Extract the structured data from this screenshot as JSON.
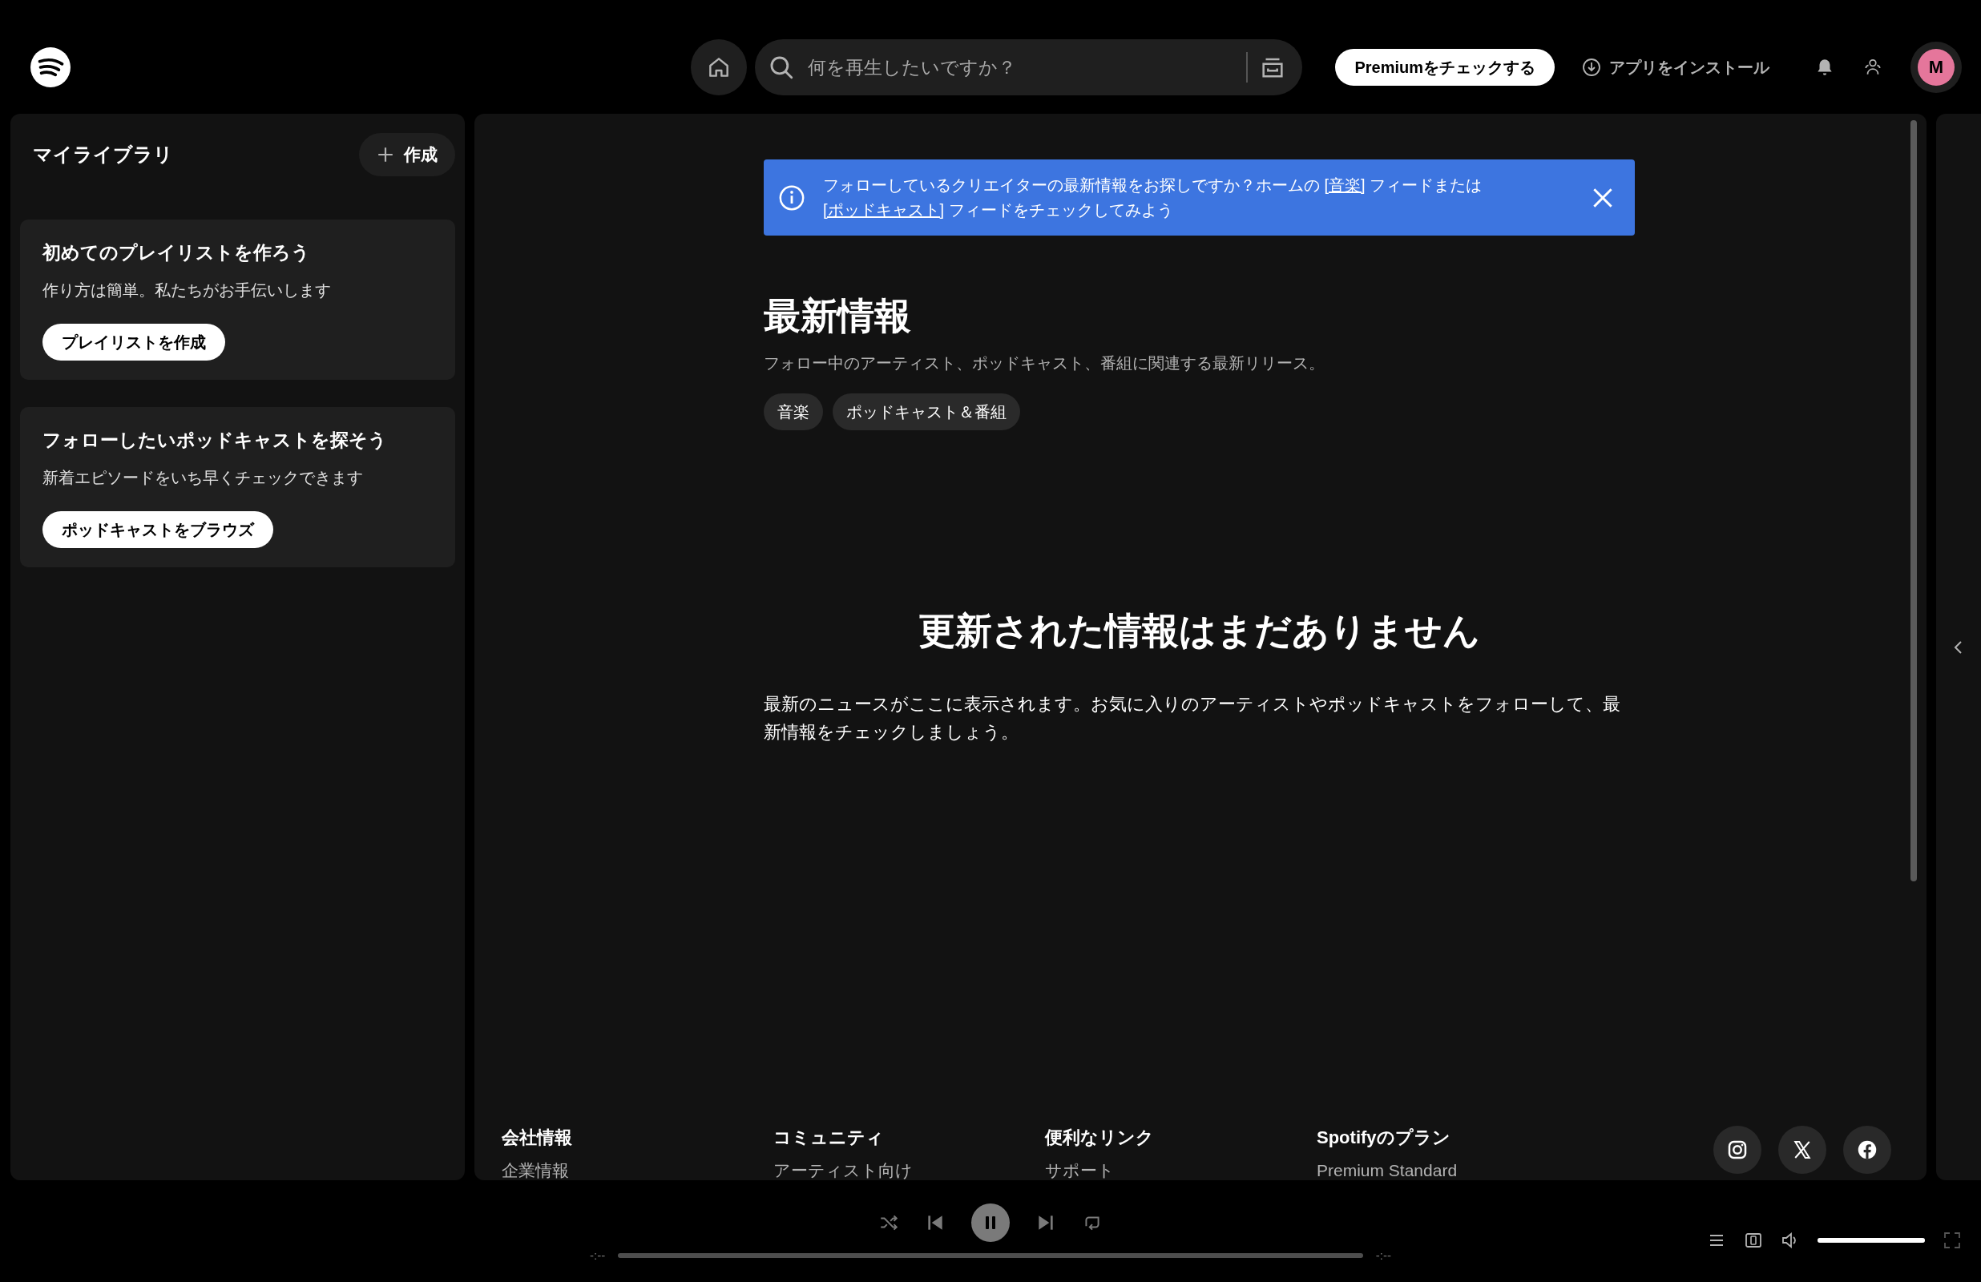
{
  "topbar": {
    "search": {
      "placeholder": "何を再生したいですか？"
    },
    "premium_button": "Premiumをチェックする",
    "install_link": "アプリをインストール",
    "avatar": "M"
  },
  "library": {
    "title": "マイライブラリ",
    "create_button": "作成",
    "cards": [
      {
        "title": "初めてのプレイリストを作ろう",
        "text": "作り方は簡単。私たちがお手伝いします",
        "button": "プレイリストを作成"
      },
      {
        "title": "フォローしたいポッドキャストを探そう",
        "text": "新着エピソードをいち早くチェックできます",
        "button": "ポッドキャストをブラウズ"
      }
    ]
  },
  "banner": {
    "segments": [
      {
        "kind": "text",
        "text": "フォローしているクリエイターの最新情報をお探しですか？ホームの "
      },
      {
        "kind": "link",
        "text": "[音楽]"
      },
      {
        "kind": "text",
        "text": " フィードまたは "
      },
      {
        "kind": "link",
        "text": "[ポッドキャスト]"
      },
      {
        "kind": "text",
        "text": " フィードをチェックしてみよう"
      }
    ]
  },
  "main": {
    "title": "最新情報",
    "subtitle": "フォロー中のアーティスト、ポッドキャスト、番組に関連する最新リリース。",
    "filters": [
      {
        "label": "音楽",
        "selected": false
      },
      {
        "label": "ポッドキャスト＆番組",
        "selected": false
      }
    ],
    "empty_title": "更新された情報はまだありません",
    "empty_text": "最新のニュースがここに表示されます。お気に入りのアーティストやポッドキャストをフォローして、最新情報をチェックしましょう。"
  },
  "footer": {
    "columns": [
      {
        "heading": "会社情報",
        "links": [
          "企業情報"
        ]
      },
      {
        "heading": "コミュニティ",
        "links": [
          "アーティスト向け"
        ]
      },
      {
        "heading": "便利なリンク",
        "links": [
          "サポート"
        ]
      },
      {
        "heading": "Spotifyのプラン",
        "links": [
          "Premium Standard"
        ]
      }
    ],
    "social": [
      {
        "kind": "instagram"
      },
      {
        "kind": "x"
      },
      {
        "kind": "facebook"
      }
    ]
  },
  "player": {
    "playing": true,
    "elapsed": "-:--",
    "remaining": "-:--",
    "progress": {
      "level": 0
    },
    "volume": {
      "level": 1.0
    }
  }
}
